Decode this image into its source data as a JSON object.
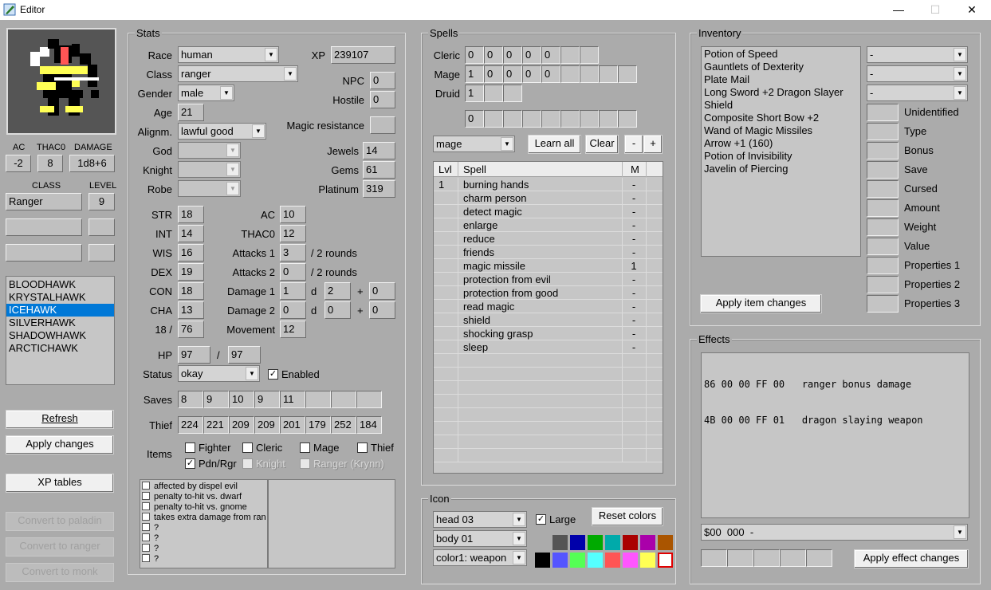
{
  "window": {
    "title": "Editor",
    "minimize": "—",
    "maximize": "☐",
    "close": "✕"
  },
  "left": {
    "ac_label": "AC",
    "thac0_label": "THAC0",
    "damage_label": "DAMAGE",
    "ac": "-2",
    "thac0": "8",
    "damage": "1d8+6",
    "class_label": "CLASS",
    "level_label": "LEVEL",
    "class": "Ranger",
    "level": "9",
    "characters": [
      "BLOODHAWK",
      "KRYSTALHAWK",
      "ICEHAWK",
      "SILVERHAWK",
      "SHADOWHAWK",
      "ARCTICHAWK"
    ],
    "selected_index": 2,
    "refresh": "Refresh",
    "apply_changes": "Apply changes",
    "xp_tables": "XP tables",
    "convert_paladin": "Convert to paladin",
    "convert_ranger": "Convert to ranger",
    "convert_monk": "Convert to monk"
  },
  "stats": {
    "group": "Stats",
    "race_label": "Race",
    "race": "human",
    "class_label": "Class",
    "class": "ranger",
    "gender_label": "Gender",
    "gender": "male",
    "age_label": "Age",
    "age": "21",
    "align_label": "Alignm.",
    "alignment": "lawful good",
    "god_label": "God",
    "knight_label": "Knight",
    "robe_label": "Robe",
    "xp_label": "XP",
    "xp": "239107",
    "npc_label": "NPC",
    "npc": "0",
    "hostile_label": "Hostile",
    "hostile": "0",
    "mr_label": "Magic resistance",
    "mr": "",
    "jewels_label": "Jewels",
    "jewels": "14",
    "gems_label": "Gems",
    "gems": "61",
    "platinum_label": "Platinum",
    "platinum": "319",
    "str_label": "STR",
    "str": "18",
    "int_label": "INT",
    "int": "14",
    "wis_label": "WIS",
    "wis": "16",
    "dex_label": "DEX",
    "dex": "19",
    "con_label": "CON",
    "con": "18",
    "cha_label": "CHA",
    "cha": "13",
    "exstr_label": "18 /",
    "exstr": "76",
    "ac_label": "AC",
    "ac": "10",
    "thac0_label": "THAC0",
    "thac0": "12",
    "att1_label": "Attacks 1",
    "att1": "3",
    "att1_suffix": "/ 2 rounds",
    "att2_label": "Attacks 2",
    "att2": "0",
    "att2_suffix": "/ 2 rounds",
    "dmg1_label": "Damage 1",
    "dmg1_n": "1",
    "d_label": "d",
    "dmg1_d": "2",
    "plus_label": "+",
    "dmg1_b": "0",
    "dmg2_label": "Damage 2",
    "dmg2_n": "0",
    "dmg2_d": "0",
    "dmg2_b": "0",
    "move_label": "Movement",
    "move": "12",
    "hp_label": "HP",
    "hp": "97",
    "hp_sep": "/",
    "hp_max": "97",
    "status_label": "Status",
    "status": "okay",
    "enabled_label": "Enabled",
    "saves_label": "Saves",
    "saves": [
      "8",
      "9",
      "10",
      "9",
      "11",
      "",
      "",
      ""
    ],
    "thief_label": "Thief",
    "thief": [
      "224",
      "221",
      "209",
      "209",
      "201",
      "179",
      "252",
      "184"
    ],
    "items_label": "Items",
    "items_checks": {
      "fighter": "Fighter",
      "cleric": "Cleric",
      "mage": "Mage",
      "thief": "Thief",
      "pdnrgr": "Pdn/Rgr",
      "knight": "Knight",
      "ranger_krynn": "Ranger (Krynn)"
    },
    "flags": [
      "affected by dispel evil",
      "penalty to-hit vs. dwarf",
      "penalty to-hit vs. gnome",
      "takes extra damage from ran",
      "?",
      "?",
      "?",
      "?"
    ]
  },
  "spells": {
    "group": "Spells",
    "cleric_label": "Cleric",
    "cleric": [
      "0",
      "0",
      "0",
      "0",
      "0",
      "",
      ""
    ],
    "mage_label": "Mage",
    "mage": [
      "1",
      "0",
      "0",
      "0",
      "0",
      "",
      "",
      "",
      ""
    ],
    "druid_label": "Druid",
    "druid": [
      "1",
      "",
      ""
    ],
    "extra": [
      "0",
      "",
      "",
      "",
      "",
      "",
      "",
      "",
      ""
    ],
    "school": "mage",
    "learn_all": "Learn all",
    "clear": "Clear",
    "minus": "-",
    "plus": "+",
    "col_lvl": "Lvl",
    "col_spell": "Spell",
    "col_m": "M",
    "rows": [
      {
        "lvl": "1",
        "spell": "burning hands",
        "m": "-"
      },
      {
        "lvl": "",
        "spell": "charm person",
        "m": "-"
      },
      {
        "lvl": "",
        "spell": "detect magic",
        "m": "-"
      },
      {
        "lvl": "",
        "spell": "enlarge",
        "m": "-"
      },
      {
        "lvl": "",
        "spell": "reduce",
        "m": "-"
      },
      {
        "lvl": "",
        "spell": "friends",
        "m": "-"
      },
      {
        "lvl": "",
        "spell": "magic missile",
        "m": "1"
      },
      {
        "lvl": "",
        "spell": "protection from evil",
        "m": "-"
      },
      {
        "lvl": "",
        "spell": "protection from good",
        "m": "-"
      },
      {
        "lvl": "",
        "spell": "read magic",
        "m": "-"
      },
      {
        "lvl": "",
        "spell": "shield",
        "m": "-"
      },
      {
        "lvl": "",
        "spell": "shocking grasp",
        "m": "-"
      },
      {
        "lvl": "",
        "spell": "sleep",
        "m": "-"
      }
    ]
  },
  "icon": {
    "group": "Icon",
    "head": "head 03",
    "body": "body 01",
    "color": "color1: weapon",
    "large_label": "Large",
    "reset_colors": "Reset colors",
    "palette": [
      "#555555",
      "#0000aa",
      "#00aa00",
      "#00aaaa",
      "#aa0000",
      "#aa00aa",
      "#aa5500",
      "#000000",
      "#5555ff",
      "#55ff55",
      "#55ffff",
      "#ff5555",
      "#ff55ff",
      "#ffff55",
      "#ffffff"
    ]
  },
  "inventory": {
    "group": "Inventory",
    "items": [
      "Potion of Speed",
      "Gauntlets of Dexterity",
      "Plate Mail",
      "Long Sword +2 Dragon Slayer",
      "Shield",
      "Composite Short Bow +2",
      "Wand of Magic Missiles",
      "Arrow +1 (160)",
      "Potion of Invisibility",
      "Javelin of Piercing"
    ],
    "dd1": "-",
    "dd2": "-",
    "dd3": "-",
    "props": [
      "Unidentified",
      "Type",
      "Bonus",
      "Save",
      "Cursed",
      "Amount",
      "Weight",
      "Value",
      "Properties 1",
      "Properties 2",
      "Properties 3"
    ],
    "apply_item": "Apply item changes"
  },
  "effects": {
    "group": "Effects",
    "lines": [
      "86 00 00 FF 00   ranger bonus damage",
      "4B 00 00 FF 01   dragon slaying weapon"
    ],
    "selector": "$00  000  -",
    "apply_effect": "Apply effect changes"
  },
  "colors": {
    "selected": "#0078d7",
    "background": "#ababab"
  }
}
